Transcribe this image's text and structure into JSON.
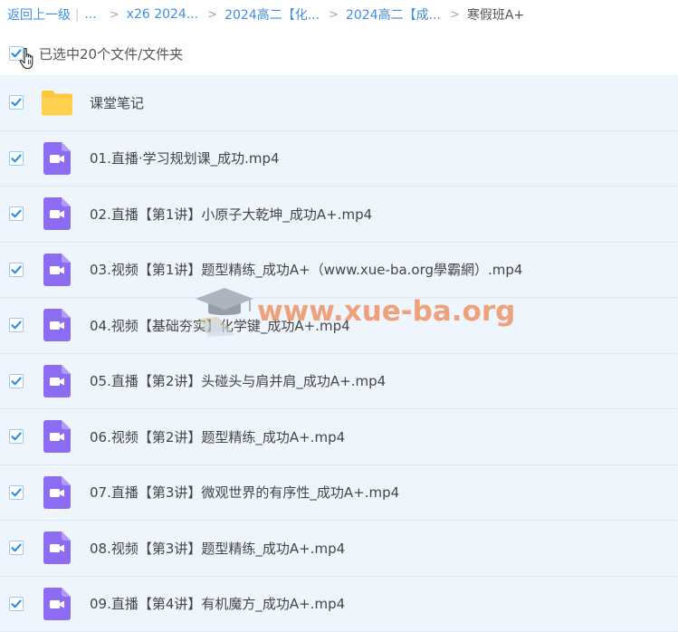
{
  "breadcrumb": {
    "back": "返回上一级",
    "ellipsis": "...",
    "items": [
      "x26 2024...",
      "2024高二【化...",
      "2024高二【成..."
    ],
    "separator": ">",
    "current": "寒假班A+"
  },
  "selection": {
    "text": "已选中20个文件/文件夹",
    "checked": true
  },
  "files": [
    {
      "name": "课堂笔记",
      "type": "folder",
      "checked": true
    },
    {
      "name": "01.直播·学习规划课_成功.mp4",
      "type": "video",
      "checked": true
    },
    {
      "name": "02.直播【第1讲】小原子大乾坤_成功A+.mp4",
      "type": "video",
      "checked": true
    },
    {
      "name": "03.视频【第1讲】题型精练_成功A+（www.xue-ba.org學霸網）.mp4",
      "type": "video",
      "checked": true
    },
    {
      "name": "04.视频【基础夯实】化学键_成功A+.mp4",
      "type": "video",
      "checked": true
    },
    {
      "name": "05.直播【第2讲】头碰头与肩并肩_成功A+.mp4",
      "type": "video",
      "checked": true
    },
    {
      "name": "06.视频【第2讲】题型精练_成功A+.mp4",
      "type": "video",
      "checked": true
    },
    {
      "name": "07.直播【第3讲】微观世界的有序性_成功A+.mp4",
      "type": "video",
      "checked": true
    },
    {
      "name": "08.视频【第3讲】题型精练_成功A+.mp4",
      "type": "video",
      "checked": true
    },
    {
      "name": "09.直播【第4讲】有机魔方_成功A+.mp4",
      "type": "video",
      "checked": true
    }
  ],
  "watermark": {
    "text": "www.xue-ba.org"
  },
  "colors": {
    "link": "#3d8ee6",
    "row_bg": "#eef5fd",
    "check": "#1f8ce8",
    "video_icon": "#8c6cf0",
    "folder_icon": "#fcc73a"
  }
}
